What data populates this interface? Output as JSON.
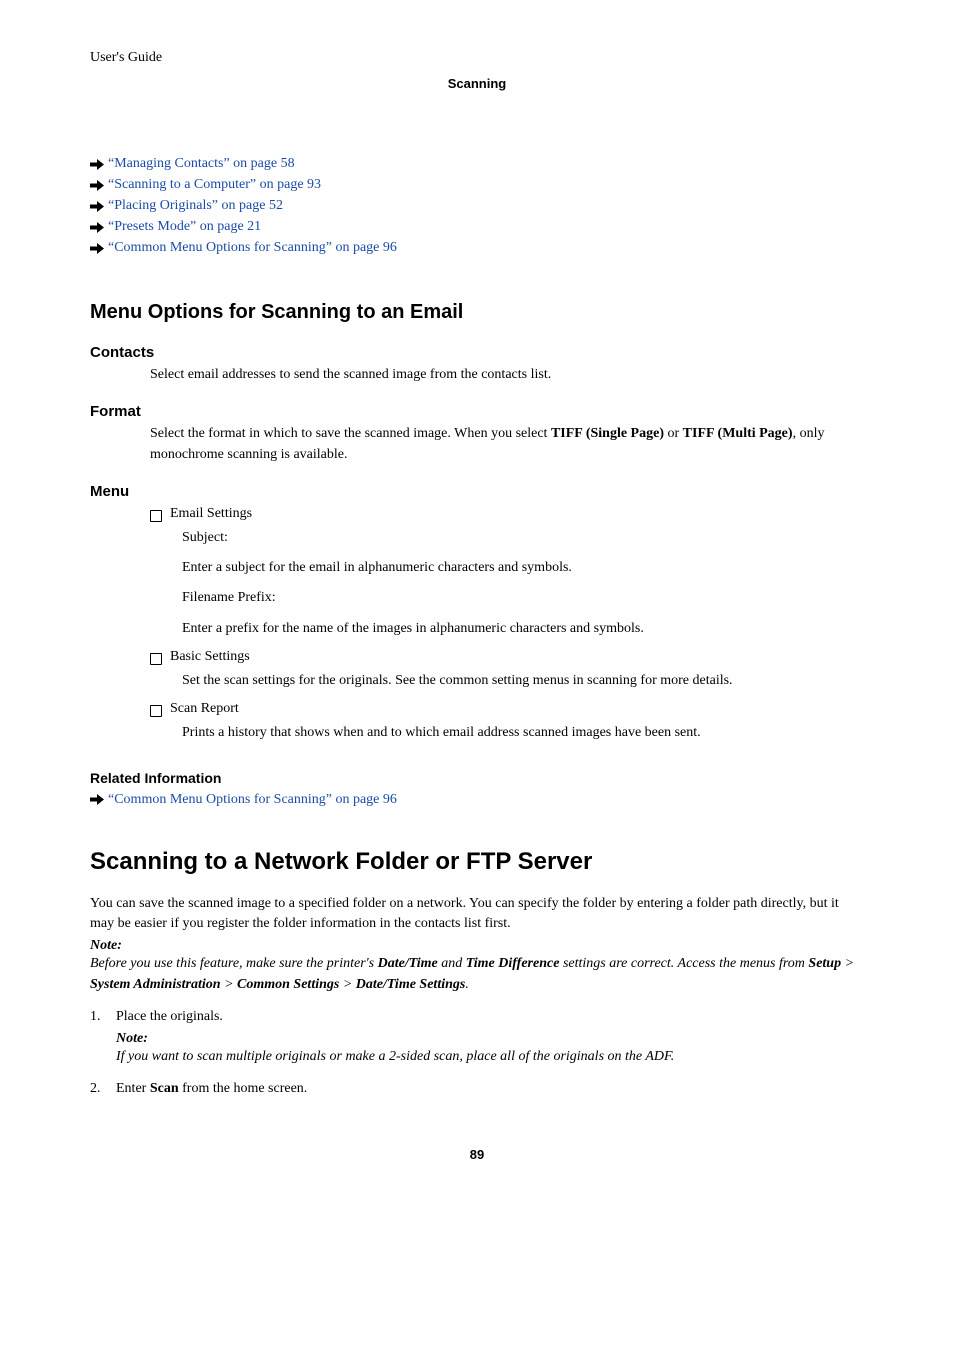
{
  "header": {
    "guide": "User's Guide",
    "section": "Scanning"
  },
  "topLinks": [
    "“Managing Contacts” on page 58",
    "“Scanning to a Computer” on page 93",
    "“Placing Originals” on page 52",
    "“Presets Mode” on page 21",
    "“Common Menu Options for Scanning” on page 96"
  ],
  "menuOptions": {
    "title": "Menu Options for Scanning to an Email",
    "contacts": {
      "label": "Contacts",
      "text": "Select email addresses to send the scanned image from the contacts list."
    },
    "format": {
      "label": "Format",
      "prefix": "Select the format in which to save the scanned image. When you select ",
      "bold1": "TIFF (Single Page)",
      "mid": " or ",
      "bold2": "TIFF (Multi Page)",
      "suffix": ", only monochrome scanning is available."
    },
    "menu": {
      "label": "Menu",
      "emailSettings": {
        "label": "Email Settings",
        "subjectLabel": "Subject:",
        "subjectText": "Enter a subject for the email in alphanumeric characters and symbols.",
        "filenameLabel": "Filename Prefix:",
        "filenameText": "Enter a prefix for the name of the images in alphanumeric characters and symbols."
      },
      "basicSettings": {
        "label": "Basic Settings",
        "text": "Set the scan settings for the originals. See the common setting menus in scanning for more details."
      },
      "scanReport": {
        "label": "Scan Report",
        "text": "Prints a history that shows when and to which email address scanned images have been sent."
      }
    },
    "relatedInfo": {
      "title": "Related Information",
      "link": "“Common Menu Options for Scanning” on page 96"
    }
  },
  "networkFolder": {
    "title": "Scanning to a Network Folder or FTP Server",
    "intro": "You can save the scanned image to a specified folder on a network. You can specify the folder by entering a folder path directly, but it may be easier if you register the folder information in the contacts list first.",
    "noteLabel": "Note:",
    "noteParts": {
      "p1": "Before you use this feature, make sure the printer's ",
      "b1": "Date/Time",
      "p2": " and ",
      "b2": "Time Difference",
      "p3": " settings are correct. Access the menus from ",
      "b3": "Setup",
      "sep": " > ",
      "b4": "System Administration",
      "b5": "Common Settings",
      "b6": "Date/Time Settings",
      "end": "."
    },
    "steps": {
      "s1": {
        "num": "1.",
        "text": "Place the originals.",
        "noteLabel": "Note:",
        "noteText": "If you want to scan multiple originals or make a 2-sided scan, place all of the originals on the ADF."
      },
      "s2": {
        "num": "2.",
        "prefix": "Enter ",
        "bold": "Scan",
        "suffix": " from the home screen."
      }
    }
  },
  "pageNumber": "89"
}
